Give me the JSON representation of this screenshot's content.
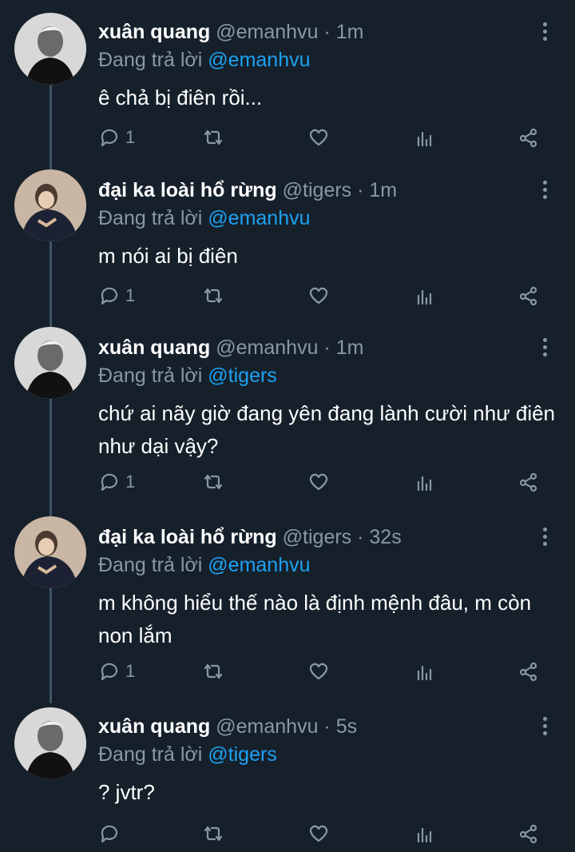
{
  "tweets": [
    {
      "name": "xuân quang",
      "handle": "@emanhvu",
      "time": "1m",
      "reply_prefix": "Đang trả lời",
      "reply_to": "@emanhvu",
      "text": "ê chả bị điên rồi...",
      "reply_count": "1",
      "avatar_icon": "person-avatar"
    },
    {
      "name": "đại ka loài hổ rừng",
      "handle": "@tigers",
      "time": "1m",
      "reply_prefix": "Đang trả lời",
      "reply_to": "@emanhvu",
      "text": "m nói ai bị điên",
      "reply_count": "1",
      "avatar_icon": "person-avatar"
    },
    {
      "name": "xuân quang",
      "handle": "@emanhvu",
      "time": "1m",
      "reply_prefix": "Đang trả lời",
      "reply_to": "@tigers",
      "text": "chứ ai nãy giờ đang yên đang lành cười như điên như dại vậy?",
      "reply_count": "1",
      "avatar_icon": "person-avatar"
    },
    {
      "name": "đại ka loài hổ rừng",
      "handle": "@tigers",
      "time": "32s",
      "reply_prefix": "Đang trả lời",
      "reply_to": "@emanhvu",
      "text": "m không hiểu thế nào là định mệnh đâu, m còn non lắm",
      "reply_count": "1",
      "avatar_icon": "person-avatar"
    },
    {
      "name": "xuân quang",
      "handle": "@emanhvu",
      "time": "5s",
      "reply_prefix": "Đang trả lời",
      "reply_to": "@tigers",
      "text": "? jvtr?",
      "reply_count": "",
      "avatar_icon": "person-avatar"
    }
  ],
  "separator": "·",
  "icons": [
    "reply-icon",
    "retweet-icon",
    "like-icon",
    "stats-icon",
    "share-icon",
    "more-icon"
  ],
  "colors": {
    "background": "#15202b",
    "muted": "#8899a6",
    "link": "#1da1f2",
    "thread_line": "#3d5466"
  }
}
